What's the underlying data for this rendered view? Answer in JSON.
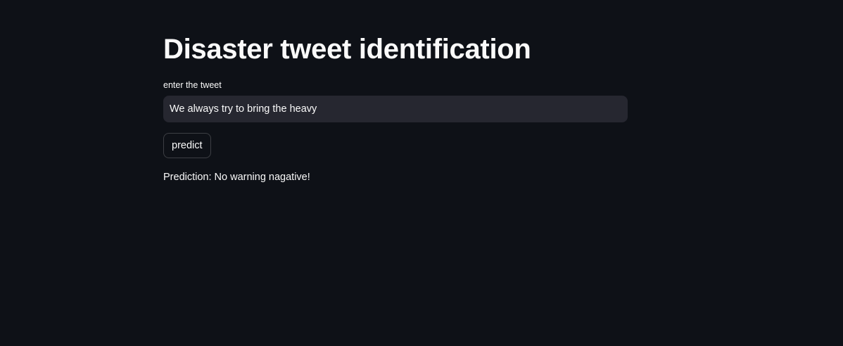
{
  "page": {
    "title": "Disaster tweet identification"
  },
  "tweet_input": {
    "label": "enter the tweet",
    "value": "We always try to bring the heavy"
  },
  "predict_button": {
    "label": "predict"
  },
  "result": {
    "text": "Prediction: No warning nagative!"
  },
  "colors": {
    "background": "#0e1117",
    "input_background": "#262730",
    "text": "#fafafa"
  }
}
